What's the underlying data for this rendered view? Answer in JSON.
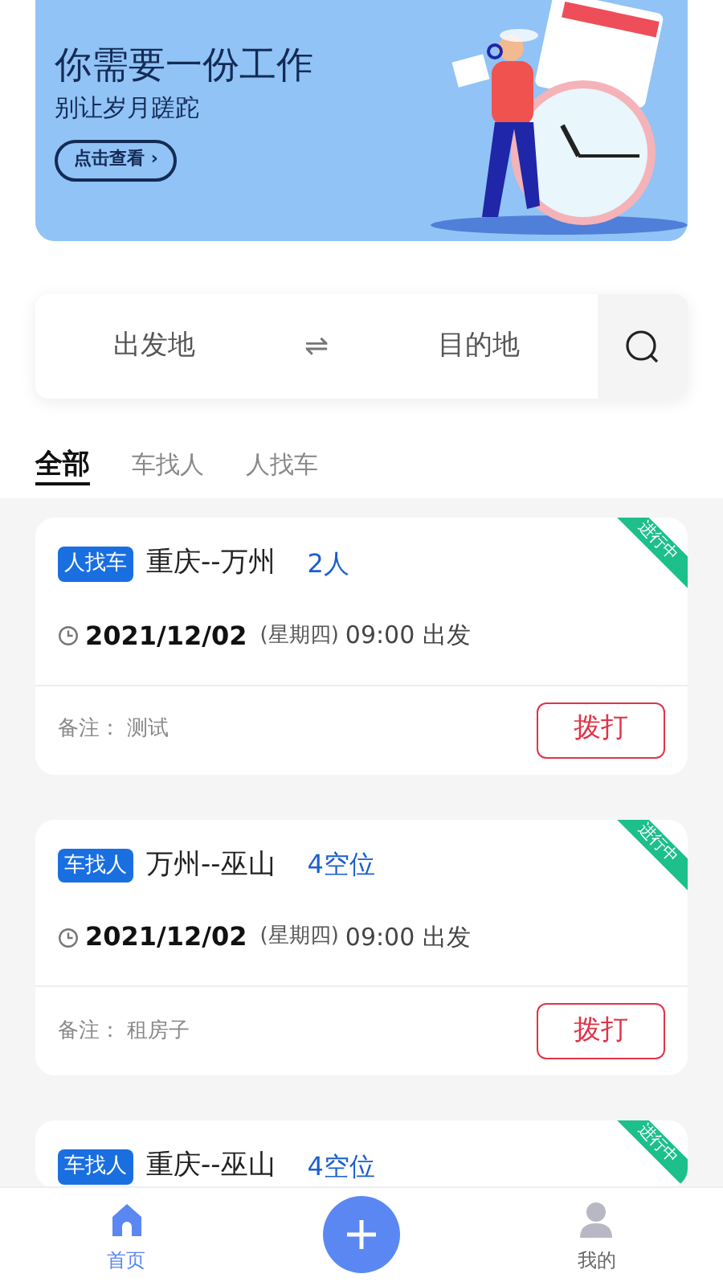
{
  "banner": {
    "title": "你需要一份工作",
    "subtitle": "别让岁月蹉跎",
    "button": "点击查看 ›"
  },
  "search": {
    "from_placeholder": "出发地",
    "swap": "⇌",
    "to_placeholder": "目的地"
  },
  "tabs": [
    {
      "label": "全部",
      "selected": true
    },
    {
      "label": "车找人",
      "selected": false
    },
    {
      "label": "人找车",
      "selected": false
    }
  ],
  "cards": [
    {
      "type_tag": "人找车",
      "route": "重庆--万州",
      "seats": "2人",
      "date": "2021/12/02",
      "weekday": "(星期四)",
      "time": "09:00 出发",
      "note_label": "备注：",
      "note": "测试",
      "call_button": "拨打",
      "status": "进行中"
    },
    {
      "type_tag": "车找人",
      "route": "万州--巫山",
      "seats": "4空位",
      "date": "2021/12/02",
      "weekday": "(星期四)",
      "time": "09:00 出发",
      "note_label": "备注：",
      "note": "租房子",
      "call_button": "拨打",
      "status": "进行中"
    },
    {
      "type_tag": "车找人",
      "route": "重庆--巫山",
      "seats": "4空位",
      "status": "进行中"
    }
  ],
  "nav": {
    "items": [
      {
        "kind": "home",
        "label": "首页",
        "selected": true
      },
      {
        "kind": "add"
      },
      {
        "kind": "profile",
        "label": "我的",
        "selected": false
      }
    ]
  }
}
